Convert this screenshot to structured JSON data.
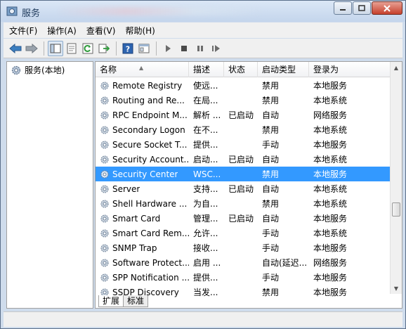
{
  "window": {
    "title": "服务"
  },
  "menu": [
    "文件(F)",
    "操作(A)",
    "查看(V)",
    "帮助(H)"
  ],
  "toolbar": [
    "back-arrow-icon",
    "forward-arrow-icon",
    "show-hide-tree-icon",
    "properties-icon",
    "refresh-icon",
    "export-list-icon",
    "help-icon",
    "console-icon",
    "play-icon",
    "stop-icon",
    "pause-icon",
    "restart-icon"
  ],
  "tree": {
    "root_label": "服务(本地)"
  },
  "table": {
    "headers": {
      "name": "名称",
      "desc": "描述",
      "status": "状态",
      "startup": "启动类型",
      "logon": "登录为"
    },
    "rows": [
      {
        "name": "Remote Registry",
        "desc": "使远...",
        "status": "",
        "startup": "禁用",
        "logon": "本地服务"
      },
      {
        "name": "Routing and Re...",
        "desc": "在局...",
        "status": "",
        "startup": "禁用",
        "logon": "本地系统"
      },
      {
        "name": "RPC Endpoint M...",
        "desc": "解析 ...",
        "status": "已启动",
        "startup": "自动",
        "logon": "网络服务"
      },
      {
        "name": "Secondary Logon",
        "desc": "在不...",
        "status": "",
        "startup": "禁用",
        "logon": "本地系统"
      },
      {
        "name": "Secure Socket T...",
        "desc": "提供...",
        "status": "",
        "startup": "手动",
        "logon": "本地服务"
      },
      {
        "name": "Security Account...",
        "desc": "启动...",
        "status": "已启动",
        "startup": "自动",
        "logon": "本地系统"
      },
      {
        "name": "Security Center",
        "desc": "WSC...",
        "status": "",
        "startup": "禁用",
        "logon": "本地服务",
        "selected": true
      },
      {
        "name": "Server",
        "desc": "支持...",
        "status": "已启动",
        "startup": "自动",
        "logon": "本地系统"
      },
      {
        "name": "Shell Hardware ...",
        "desc": "为自...",
        "status": "",
        "startup": "禁用",
        "logon": "本地系统"
      },
      {
        "name": "Smart Card",
        "desc": "管理...",
        "status": "已启动",
        "startup": "自动",
        "logon": "本地服务"
      },
      {
        "name": "Smart Card Rem...",
        "desc": "允许...",
        "status": "",
        "startup": "手动",
        "logon": "本地系统"
      },
      {
        "name": "SNMP Trap",
        "desc": "接收...",
        "status": "",
        "startup": "手动",
        "logon": "本地服务"
      },
      {
        "name": "Software Protect...",
        "desc": "启用 ...",
        "status": "",
        "startup": "自动(延迟...",
        "logon": "网络服务"
      },
      {
        "name": "SPP Notification ...",
        "desc": "提供...",
        "status": "",
        "startup": "手动",
        "logon": "本地服务"
      },
      {
        "name": "SSDP Discovery",
        "desc": "当发...",
        "status": "",
        "startup": "禁用",
        "logon": "本地服务"
      }
    ]
  },
  "tabs": [
    "扩展",
    "标准"
  ],
  "colors": {
    "selection": "#3399ff",
    "window_frame": "#cfdcec",
    "close_button": "#c6412d"
  }
}
